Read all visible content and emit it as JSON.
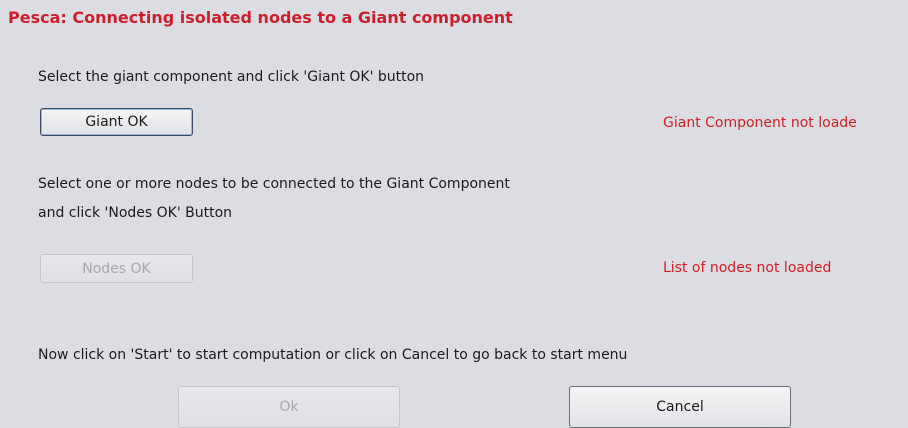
{
  "title": "Pesca: Connecting isolated nodes to a Giant component",
  "giant": {
    "instruction": "Select the giant component and click 'Giant OK' button",
    "button_label": "Giant OK",
    "status": "Giant Component not loade"
  },
  "nodes": {
    "instruction_line1": "Select one or more nodes to be connected to the Giant Component",
    "instruction_line2": "and click 'Nodes OK' Button",
    "button_label": "Nodes OK",
    "status": "List of nodes not loaded"
  },
  "footer": {
    "instruction": "Now click on 'Start' to start computation or click on Cancel to go back to start menu",
    "ok_label": "Ok",
    "cancel_label": "Cancel"
  },
  "colors": {
    "title": "#cc1f2e",
    "status": "#d11f26",
    "panel_bg": "#dcdde2"
  }
}
